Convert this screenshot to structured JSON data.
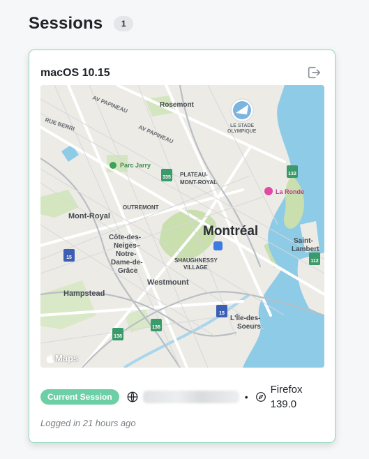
{
  "header": {
    "title": "Sessions",
    "count": "1"
  },
  "session": {
    "os": "macOS 10.15",
    "badge": "Current Session",
    "ip_masked": "",
    "separator": "•",
    "browser": "Firefox 139.0",
    "logged_in": "Logged in 21 hours ago",
    "logout_icon": "logout-icon",
    "ip_icon": "globe-icon",
    "browser_icon": "compass-icon"
  },
  "map": {
    "attribution": "Maps",
    "city": "Montréal",
    "labels": {
      "rosemont": "Rosemont",
      "av_papineau_1": "AV PAPINEAU",
      "av_papineau_2": "AV PAPINEAU",
      "rue_berri": "RUE BERRI",
      "parc_jarry": "Parc Jarry",
      "stade_1": "LE STADE",
      "stade_2": "OLYMPIQUE",
      "plateau_1": "PLATEAU-",
      "plateau_2": "MONT-ROYAL",
      "outremont": "OUTREMONT",
      "la_ronde": "La Ronde",
      "mont_royal": "Mont-Royal",
      "cdn_1": "Côte-des-",
      "cdn_2": "Neiges–",
      "cdn_3": "Notre-",
      "cdn_4": "Dame-de-",
      "cdn_5": "Grâce",
      "shaughnessy_1": "SHAUGHNESSY",
      "shaughnessy_2": "VILLAGE",
      "westmount": "Westmount",
      "hampstead": "Hampstead",
      "saint_lambert_1": "Saint-",
      "saint_lambert_2": "Lambert",
      "ile_soeurs_1": "L'Île-des-",
      "ile_soeurs_2": "Soeurs",
      "shield_335": "335",
      "shield_132a": "132",
      "shield_132b": "132",
      "shield_112": "112",
      "shield_15a": "15",
      "shield_15b": "15",
      "shield_136": "136",
      "shield_138": "138"
    }
  },
  "colors": {
    "badge_green": "#6ccfa6",
    "card_border": "#8fd6b8",
    "water": "#8ecbe6",
    "park": "#c9dfae"
  }
}
